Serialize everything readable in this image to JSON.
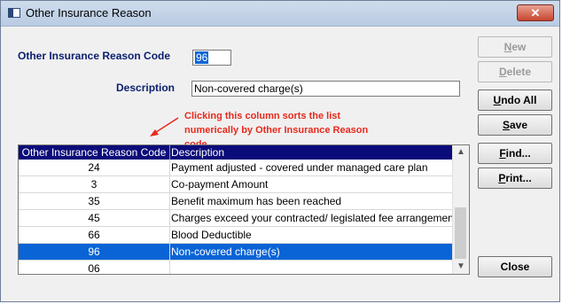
{
  "window": {
    "title": "Other Insurance Reason",
    "close_glyph": "✕"
  },
  "form": {
    "code_label": "Other Insurance Reason Code",
    "code_value": "96",
    "description_label": "Description",
    "description_value": "Non-covered charge(s)"
  },
  "annotation": {
    "text": "Clicking this column sorts the list numerically by Other Insurance Reason code",
    "color": "#e8291c"
  },
  "grid": {
    "headers": [
      "Other Insurance Reason Code",
      "Description"
    ],
    "rows": [
      {
        "code": "24",
        "description": "Payment adjusted - covered under managed care plan"
      },
      {
        "code": "3",
        "description": "Co-payment Amount"
      },
      {
        "code": "35",
        "description": "Benefit maximum has been reached"
      },
      {
        "code": "45",
        "description": "Charges exceed your contracted/ legislated fee arrangement"
      },
      {
        "code": "66",
        "description": "Blood Deductible"
      },
      {
        "code": "96",
        "description": "Non-covered charge(s)",
        "selected": true
      },
      {
        "code": "06",
        "description": ""
      }
    ]
  },
  "buttons": {
    "new": "New",
    "delete": "Delete",
    "undo_all": "Undo All",
    "save": "Save",
    "find": "Find...",
    "print": "Print...",
    "close": "Close"
  },
  "colors": {
    "header_bg": "#0b0b7a",
    "selection": "#0a64d6",
    "label": "#0a1f6e"
  }
}
